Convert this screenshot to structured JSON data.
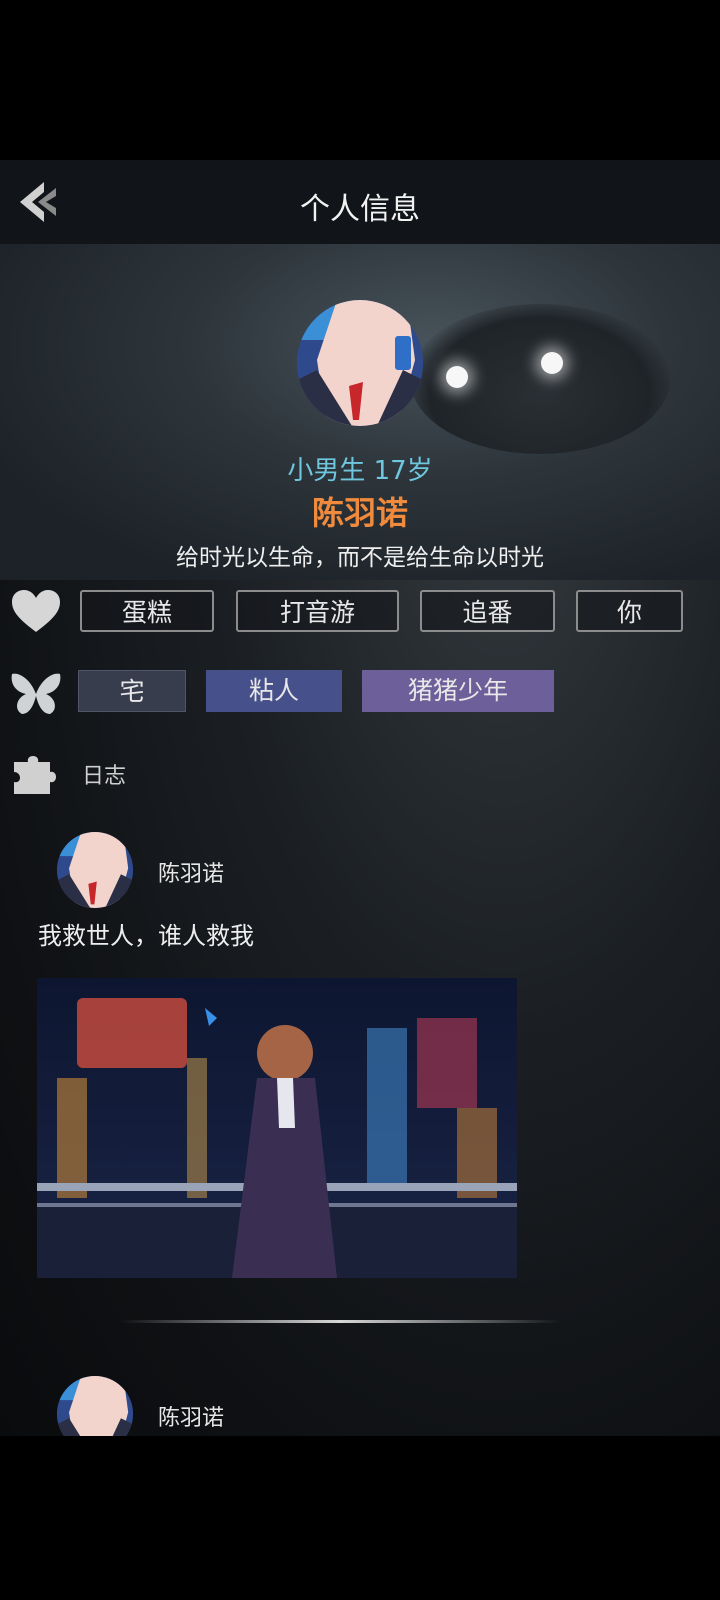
{
  "header": {
    "title": "个人信息"
  },
  "profile": {
    "meta": "小男生 17岁",
    "name": "陈羽诺",
    "motto": "给时光以生命，而不是给生命以时光"
  },
  "hobbies": [
    "蛋糕",
    "打音游",
    "追番",
    "你"
  ],
  "personality": [
    "宅",
    "粘人",
    "猪猪少年"
  ],
  "journal": {
    "label": "日志"
  },
  "posts": [
    {
      "author": "陈羽诺",
      "text": "我救世人，谁人救我"
    },
    {
      "author": "陈羽诺"
    }
  ],
  "colors": {
    "accent_name": "#f08a3c",
    "accent_meta": "#6fc6df"
  }
}
